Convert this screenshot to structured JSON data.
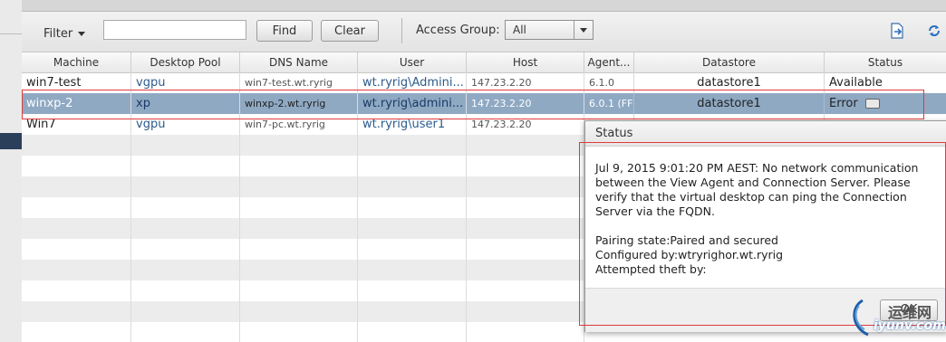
{
  "toolbar": {
    "filter_label": "Filter",
    "filter_value": "",
    "find_label": "Find",
    "clear_label": "Clear",
    "access_group_label": "Access Group:",
    "access_group_value": "All",
    "export_icon": "export-icon",
    "refresh_icon": "refresh-icon"
  },
  "table": {
    "columns": [
      "Machine",
      "Desktop Pool",
      "DNS Name",
      "User",
      "Host",
      "Agent...",
      "Datastore",
      "Status"
    ],
    "rows": [
      {
        "machine": "win7-test",
        "pool": "vgpu",
        "dns": "win7-test.wt.ryrig",
        "user": "wt.ryrig\\Admini...",
        "host": "147.23.2.20",
        "agent": "6.1.0",
        "datastore": "datastore1",
        "status": "Available"
      },
      {
        "machine": "winxp-2",
        "pool": "xp",
        "dns": "winxp-2.wt.ryrig",
        "user": "wt.ryrig\\admini...",
        "host": "147.23.2.20",
        "agent": "6.0.1 (FF",
        "datastore": "datastore1",
        "status": "Error"
      },
      {
        "machine": "Win7",
        "pool": "vgpu",
        "dns": "win7-pc.wt.ryrig",
        "user": "wt.ryrig\\user1",
        "host": "147.23.2.20",
        "agent": "",
        "datastore": "",
        "status": ""
      }
    ]
  },
  "dialog": {
    "title": "Status",
    "message": "Jul 9, 2015 9:01:20 PM AEST: No network communication between the View Agent and Connection Server. Please verify that the virtual desktop can ping the Connection Server via the FQDN.",
    "pairing_state": "Pairing state:Paired and secured",
    "configured_by": "Configured by:wtryrighor.wt.ryrig",
    "attempted_theft": "Attempted theft by:",
    "ok_label": "OK"
  },
  "watermark": {
    "line1": "运维网",
    "line2": "iyunv.com"
  },
  "colors": {
    "selected_row": "#8fa9c3",
    "highlight_box": "#e03a3a",
    "link": "#2b5b8c"
  }
}
